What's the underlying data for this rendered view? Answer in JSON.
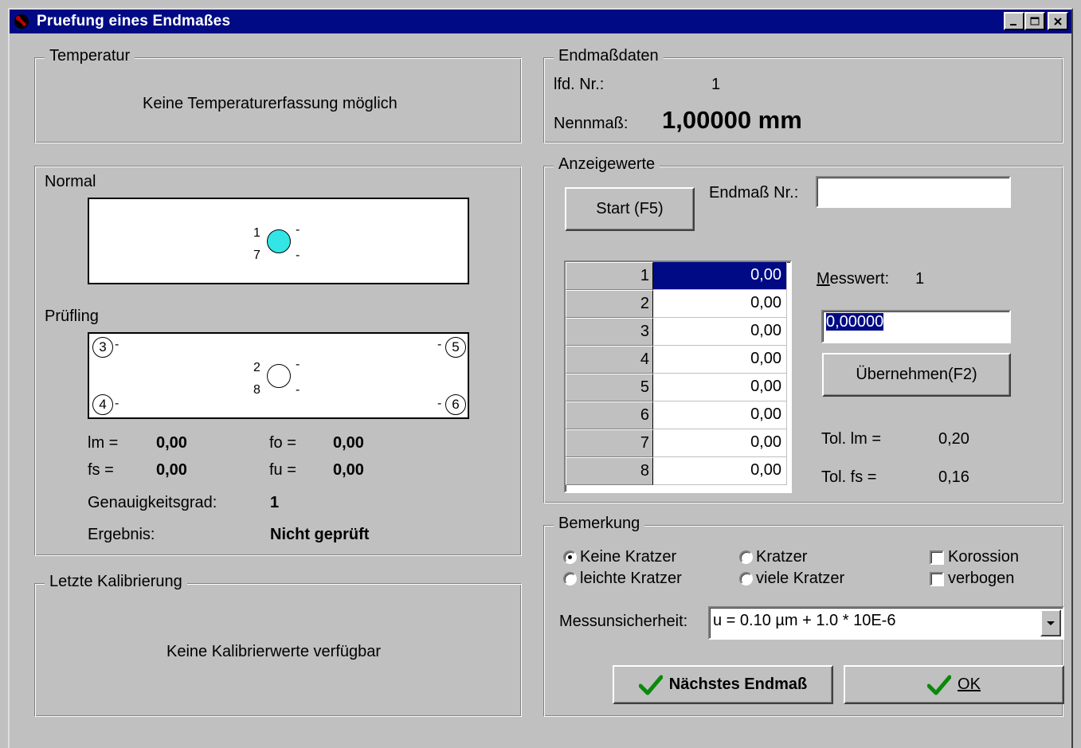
{
  "window": {
    "title": "Pruefung eines Endmaßes",
    "minimize_glyph": "_",
    "maximize_glyph": "□",
    "close_glyph": "✕"
  },
  "temperatur": {
    "legend": "Temperatur",
    "message": "Keine Temperaturerfassung möglich"
  },
  "normal": {
    "label": "Normal",
    "sensor_top_num": "1",
    "sensor_bottom_num": "7",
    "dash_top": "-",
    "dash_bottom": "-",
    "sensor_color": "#33e5e5"
  },
  "pruefling": {
    "label": "Prüfling",
    "corner_3": "3",
    "corner_4": "4",
    "corner_5": "5",
    "corner_6": "6",
    "sensor_top_num": "2",
    "sensor_bottom_num": "8",
    "dash": "-"
  },
  "results": {
    "lm_label": "lm =",
    "lm_value": "0,00",
    "fo_label": "fo =",
    "fo_value": "0,00",
    "fs_label": "fs =",
    "fs_value": "0,00",
    "fu_label": "fu =",
    "fu_value": "0,00",
    "genauigkeit_label": "Genauigkeitsgrad:",
    "genauigkeit_value": "1",
    "ergebnis_label": "Ergebnis:",
    "ergebnis_value": "Nicht geprüft"
  },
  "kalibrierung": {
    "legend": "Letzte Kalibrierung",
    "message": "Keine Kalibrierwerte verfügbar"
  },
  "endmassdaten": {
    "legend": "Endmaßdaten",
    "lfd_label": "lfd. Nr.:",
    "lfd_value": "1",
    "nenn_label": "Nennmaß:",
    "nenn_value": "1,00000 mm"
  },
  "anzeige": {
    "legend": "Anzeigewerte",
    "start_button": "Start (F5)",
    "endmass_nr_label": "Endmaß Nr.:",
    "endmass_nr_value": "",
    "messwert_label": "Messwert:",
    "messwert_index": "1",
    "messwert_input": "0,00000",
    "uebernehmen_button": "Übernehmen(F2)",
    "tol_lm_label": "Tol. lm =",
    "tol_lm_value": "0,20",
    "tol_fs_label": "Tol. fs =",
    "tol_fs_value": "0,16",
    "rows": [
      {
        "num": "1",
        "value": "0,00"
      },
      {
        "num": "2",
        "value": "0,00"
      },
      {
        "num": "3",
        "value": "0,00"
      },
      {
        "num": "4",
        "value": "0,00"
      },
      {
        "num": "5",
        "value": "0,00"
      },
      {
        "num": "6",
        "value": "0,00"
      },
      {
        "num": "7",
        "value": "0,00"
      },
      {
        "num": "8",
        "value": "0,00"
      }
    ]
  },
  "bemerkung": {
    "legend": "Bemerkung",
    "keine_kratzer": "Keine Kratzer",
    "kratzer": "Kratzer",
    "korossion": "Korossion",
    "leichte_kratzer": "leichte Kratzer",
    "viele_kratzer": "viele Kratzer",
    "verbogen": "verbogen",
    "selected": "Keine Kratzer",
    "messunsicherheit_label": "Messunsicherheit:",
    "messunsicherheit_value": "u = 0.10 µm + 1.0 * 10E-6"
  },
  "buttons": {
    "naechstes": "Nächstes Endmaß",
    "ok": "OK"
  },
  "colors": {
    "titlebar": "#000a84",
    "face": "#c0c0c0",
    "checkmark": "#0a8a0a"
  }
}
